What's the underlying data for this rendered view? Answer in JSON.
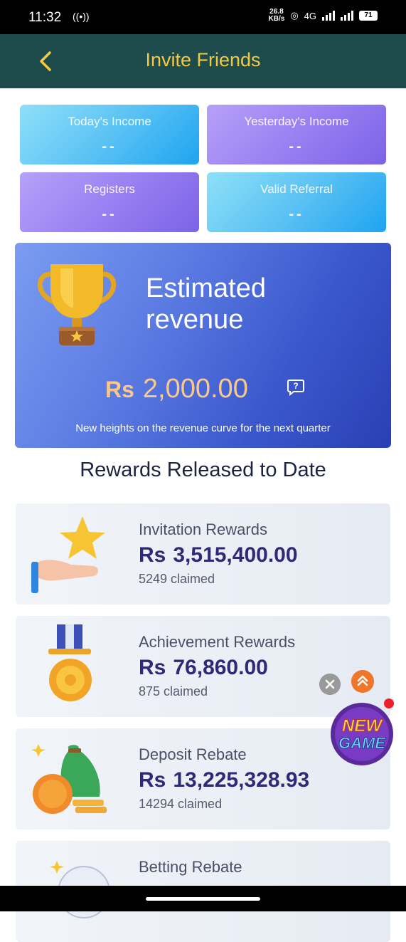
{
  "status_bar": {
    "time": "11:32",
    "data_rate_value": "26.8",
    "data_rate_unit": "KB/s",
    "network": "4G",
    "battery": "71"
  },
  "header": {
    "title": "Invite Friends"
  },
  "stats": [
    {
      "label": "Today's Income",
      "value": "--"
    },
    {
      "label": "Yesterday's Income",
      "value": "--"
    },
    {
      "label": "Registers",
      "value": "--"
    },
    {
      "label": "Valid Referral",
      "value": "--"
    }
  ],
  "revenue": {
    "title": "Estimated revenue",
    "currency": "Rs",
    "amount": "2,000.00",
    "subtitle": "New heights on the revenue curve for the next quarter"
  },
  "rewards": {
    "section_title": "Rewards Released to Date",
    "items": [
      {
        "label": "Invitation Rewards",
        "currency": "Rs",
        "amount": "3,515,400.00",
        "claimed": "5249 claimed"
      },
      {
        "label": "Achievement Rewards",
        "currency": "Rs",
        "amount": "76,860.00",
        "claimed": "875 claimed"
      },
      {
        "label": "Deposit Rebate",
        "currency": "Rs",
        "amount": "13,225,328.93",
        "claimed": "14294 claimed"
      },
      {
        "label": "Betting Rebate",
        "currency": "",
        "amount": "",
        "claimed": ""
      }
    ]
  },
  "floating": {
    "badge_line1": "NEW",
    "badge_line2": "GAME"
  },
  "colors": {
    "header_bg": "#1e4c4c",
    "title_gold": "#f5c842",
    "amount_navy": "#2d2a78"
  }
}
